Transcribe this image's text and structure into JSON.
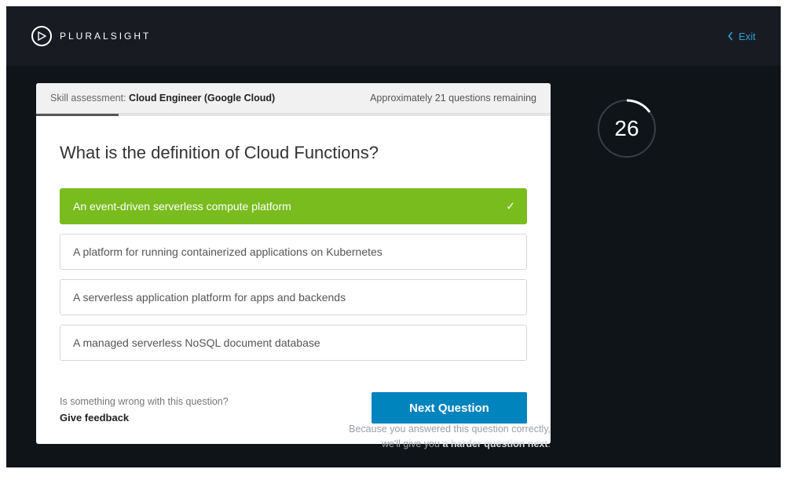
{
  "brand": {
    "name": "PLURALSIGHT"
  },
  "exit_label": "Exit",
  "header": {
    "label": "Skill assessment:",
    "name": "Cloud Engineer (Google Cloud)",
    "remaining": "Approximately 21 questions remaining",
    "progress_percent": 16
  },
  "question": "What is the definition of Cloud Functions?",
  "options": [
    {
      "text": "An event-driven serverless compute platform",
      "correct": true
    },
    {
      "text": "A platform for running containerized applications on Kubernetes",
      "correct": false
    },
    {
      "text": "A serverless application platform for apps and backends",
      "correct": false
    },
    {
      "text": "A managed serverless NoSQL document database",
      "correct": false
    }
  ],
  "feedback": {
    "prompt": "Is something wrong with this question?",
    "link": "Give feedback"
  },
  "next_label": "Next Question",
  "timer": {
    "value": "26",
    "fraction": 0.15
  },
  "result": {
    "line1": "Because you answered this question correctly,",
    "line2_pre": "we'll give you ",
    "line2_bold": "a harder question next",
    "line2_post": "."
  }
}
